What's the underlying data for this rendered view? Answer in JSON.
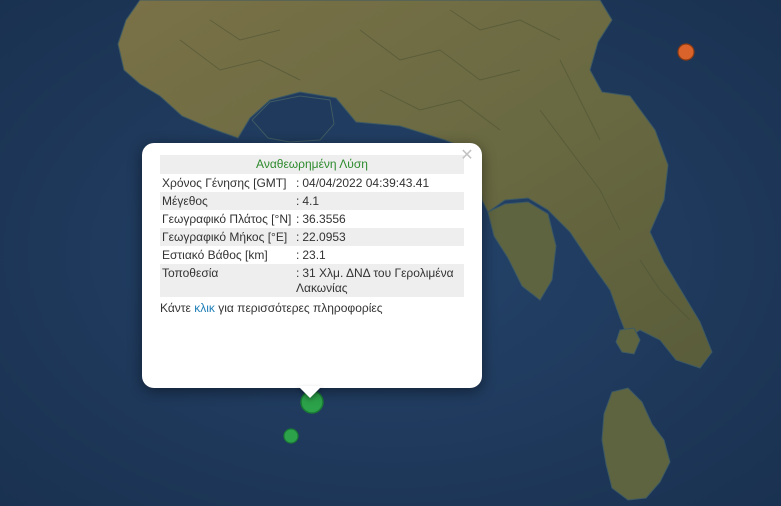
{
  "colors": {
    "sea": "#1f3a5c",
    "land": "#6f6a46",
    "event_green": "#2ca24a",
    "event_orange": "#d9632a"
  },
  "popup": {
    "header": "Αναθεωρημένη Λύση",
    "close_symbol": "✕",
    "rows": [
      {
        "label": "Χρόνος Γένησης [GMT]",
        "value": "04/04/2022 04:39:43.41"
      },
      {
        "label": "Μέγεθος",
        "value": "4.1"
      },
      {
        "label": "Γεωγραφικό Πλάτος [°N]",
        "value": "36.3556"
      },
      {
        "label": "Γεωγραφικό Μήκος [°E]",
        "value": "22.0953"
      },
      {
        "label": "Εστιακό Βάθος [km]",
        "value": "23.1"
      },
      {
        "label": "Τοποθεσία",
        "value": "31 Χλμ. ΔΝΔ του Γερολιμένα Λακωνίας"
      }
    ],
    "more_prefix": "Κάντε ",
    "more_link": "κλικ",
    "more_suffix": " για περισσότερες πληροφορίες"
  },
  "markers": [
    {
      "type": "earthquake",
      "color": "green",
      "selected": true
    },
    {
      "type": "earthquake",
      "color": "green",
      "selected": false
    },
    {
      "type": "earthquake",
      "color": "orange",
      "selected": false
    }
  ]
}
